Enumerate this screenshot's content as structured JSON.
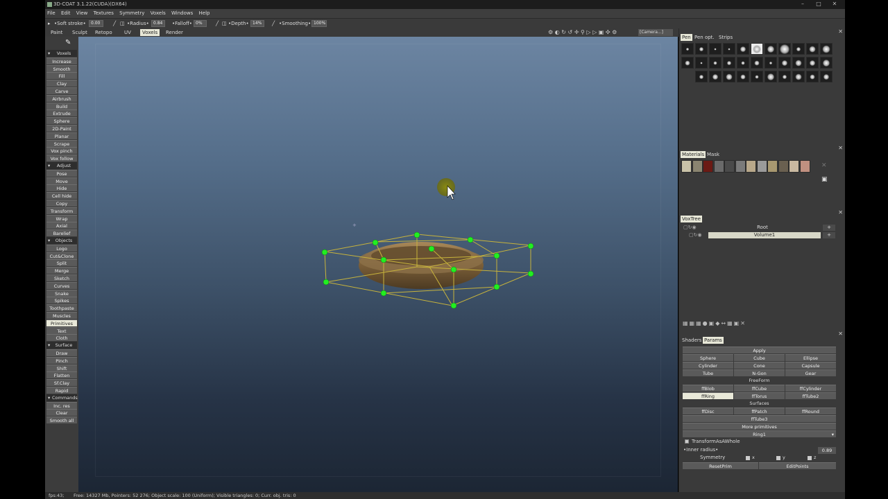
{
  "window": {
    "title": "3D-COAT 3.1.22(CUDA)(DX64)",
    "controls": [
      "–",
      "□",
      "✕"
    ]
  },
  "menu": [
    "File",
    "Edit",
    "View",
    "Textures",
    "Symmetry",
    "Voxels",
    "Windows",
    "Help"
  ],
  "toolbar": {
    "soft_stroke_label": "•Soft stroke•",
    "soft_stroke_value": "0.00",
    "radius_label": "•Radius•",
    "radius_value": "0.84",
    "falloff_label": "•Falloff•",
    "falloff_value": "0%",
    "depth_label": "•Depth•",
    "depth_value": "14%",
    "smoothing_label": "•Smoothing•",
    "smoothing_value": "100%"
  },
  "tabs": [
    "Paint",
    "Sculpt",
    "Retopo",
    "UV",
    "Voxels",
    "Render"
  ],
  "active_tab": "Voxels",
  "camera_label": "[Camera...]",
  "left_panel": {
    "items": [
      {
        "type": "section",
        "label": "Voxels"
      },
      {
        "type": "button",
        "label": "Increase"
      },
      {
        "type": "button",
        "label": "Smooth"
      },
      {
        "type": "button",
        "label": "Fill"
      },
      {
        "type": "button",
        "label": "Clay"
      },
      {
        "type": "button",
        "label": "Carve"
      },
      {
        "type": "button",
        "label": "Airbrush"
      },
      {
        "type": "button",
        "label": "Build"
      },
      {
        "type": "button",
        "label": "Extrude"
      },
      {
        "type": "button",
        "label": "Sphere"
      },
      {
        "type": "button",
        "label": "2D-Paint"
      },
      {
        "type": "button",
        "label": "Planar"
      },
      {
        "type": "button",
        "label": "Scrape"
      },
      {
        "type": "button",
        "label": "Vox pinch"
      },
      {
        "type": "button",
        "label": "Vox follow"
      },
      {
        "type": "section",
        "label": "Adjust"
      },
      {
        "type": "button",
        "label": "Pose"
      },
      {
        "type": "button",
        "label": "Move"
      },
      {
        "type": "button",
        "label": "Hide"
      },
      {
        "type": "button",
        "label": "Cell hide"
      },
      {
        "type": "button",
        "label": "Copy"
      },
      {
        "type": "button",
        "label": "Transform"
      },
      {
        "type": "button",
        "label": "Wrap"
      },
      {
        "type": "button",
        "label": "Axial"
      },
      {
        "type": "button",
        "label": "Barelief"
      },
      {
        "type": "section",
        "label": "Objects"
      },
      {
        "type": "button",
        "label": "Logo"
      },
      {
        "type": "button",
        "label": "Cut&Clone"
      },
      {
        "type": "button",
        "label": "Split"
      },
      {
        "type": "button",
        "label": "Merge"
      },
      {
        "type": "button",
        "label": "Sketch"
      },
      {
        "type": "button",
        "label": "Curves"
      },
      {
        "type": "button",
        "label": "Snake"
      },
      {
        "type": "button",
        "label": "Spikes"
      },
      {
        "type": "button",
        "label": "Toothpaste"
      },
      {
        "type": "button",
        "label": "Muscles"
      },
      {
        "type": "button",
        "label": "Primitives",
        "active": true
      },
      {
        "type": "button",
        "label": "Text"
      },
      {
        "type": "button",
        "label": "Cloth"
      },
      {
        "type": "section",
        "label": "Surface"
      },
      {
        "type": "button",
        "label": "Draw"
      },
      {
        "type": "button",
        "label": "Pinch"
      },
      {
        "type": "button",
        "label": "Shift"
      },
      {
        "type": "button",
        "label": "Flatten"
      },
      {
        "type": "button",
        "label": "Sf.Clay"
      },
      {
        "type": "button",
        "label": "Rapid"
      },
      {
        "type": "section",
        "label": "Commands"
      },
      {
        "type": "button",
        "label": "Inc. res"
      },
      {
        "type": "button",
        "label": "Clear"
      },
      {
        "type": "button",
        "label": "Smooth all"
      }
    ]
  },
  "pen_panel": {
    "tabs": [
      "Pen",
      "Pen opt.",
      "Strips"
    ],
    "active_tab": "Pen"
  },
  "materials_panel": {
    "tabs": [
      "Materials",
      "Mask"
    ],
    "active_tab": "Materials",
    "swatch_colors": [
      "#c9c2a8",
      "#8a8470",
      "#6b1a14",
      "#6a6a6a",
      "#4a4a4a",
      "#7a7a7a",
      "#b8a88a",
      "#9a9a9a",
      "#a89870",
      "#6a6050",
      "#c8b8a0",
      "#c09080"
    ]
  },
  "voxtree": {
    "tab": "VoxTree",
    "rows": [
      {
        "label": "Root",
        "selected": false
      },
      {
        "label": "Volume1",
        "selected": true
      }
    ],
    "plus": "+"
  },
  "params_panel": {
    "tabs": [
      "Shaders",
      "Params"
    ],
    "active_tab": "Params",
    "apply": "Apply",
    "basic": [
      "Sphere",
      "Cube",
      "Ellipse",
      "Cylinder",
      "Cone",
      "Capsule",
      "Tube",
      "N-Gon",
      "Gear"
    ],
    "freeform_header": "FreeForm",
    "freeform": [
      "ffBlob",
      "ffCube",
      "ffCylinder",
      "ffRing",
      "ffTorus",
      "ffTube2"
    ],
    "freeform_active": "ffRing",
    "surfaces_header": "Surfaces",
    "surfaces": [
      "ffDisc",
      "ffPatch",
      "ffRound"
    ],
    "fftube3": "ffTube3",
    "more_primitives": "More primitives",
    "dropdown_value": "Ring1",
    "transform_whole": "TransformAsAWhole",
    "inner_radius_label": "•Inner radius•",
    "inner_radius_value": "0.89",
    "symmetry_label": "Symmetry",
    "sym_axes": [
      "x",
      "y",
      "z"
    ],
    "reset_prim": "ResetPrim",
    "edit_points": "EditPoints"
  },
  "status": {
    "fps": "fps:43;",
    "info": "Free: 14327 Mb, Pointers: 52 276; Object scale: 100 (Uniform); Visible triangles: 0; Curr. obj. tris: 0"
  },
  "colors": {
    "control_point": "#22ee22",
    "cage_line": "#c8b43c",
    "ring": "#7a6038",
    "brush_cursor": "#8a8a10"
  }
}
